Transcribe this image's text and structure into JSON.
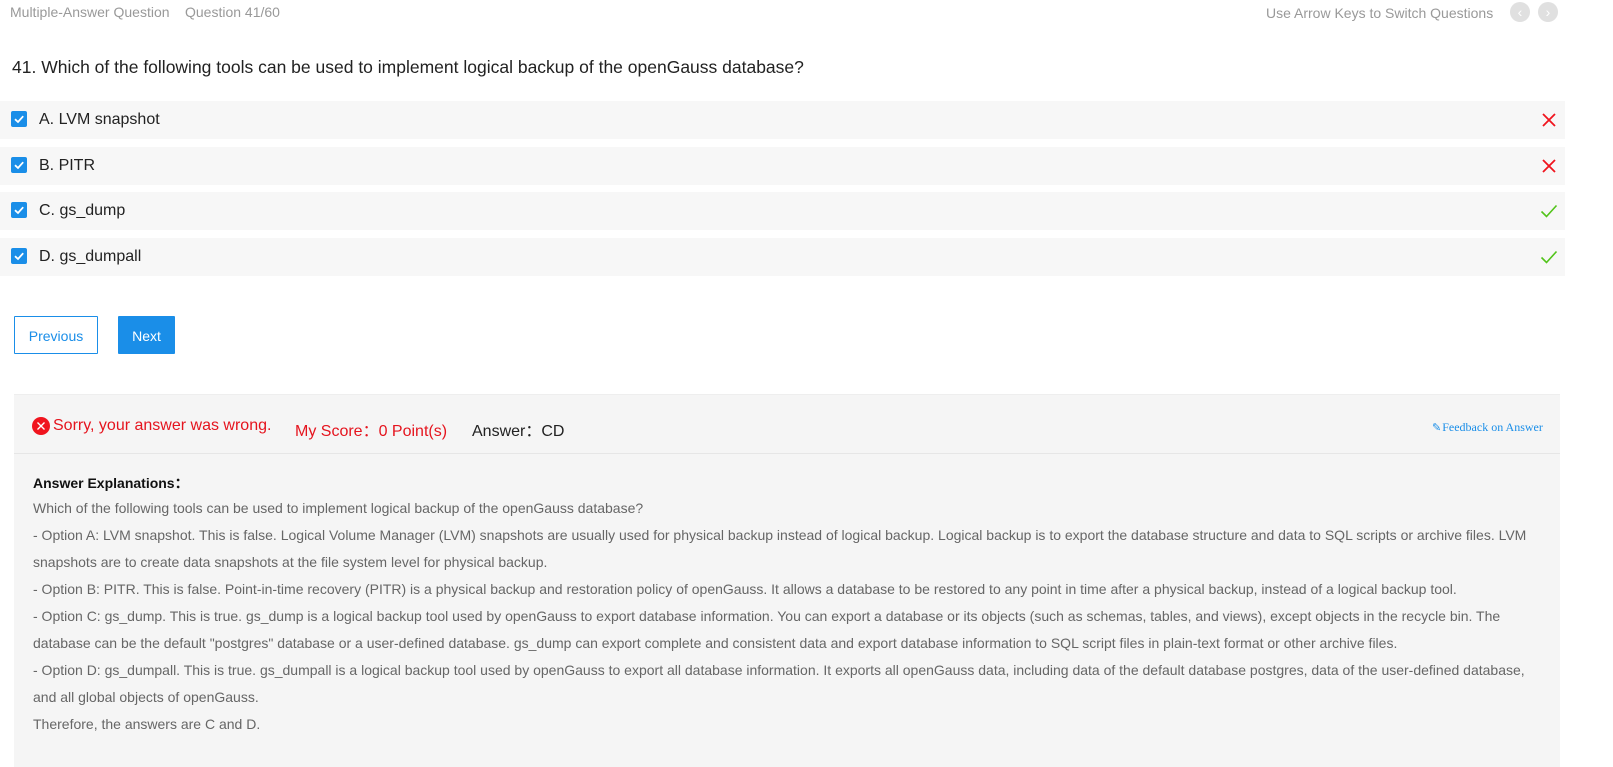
{
  "header": {
    "question_type": "Multiple-Answer Question",
    "question_number": "Question 41/60",
    "hint": "Use Arrow Keys to Switch Questions",
    "prev_arrow": "‹",
    "next_arrow": "›"
  },
  "question": {
    "text": "41. Which of the following tools can be used to implement logical backup of the openGauss database?"
  },
  "options": [
    {
      "label": "A. LVM snapshot",
      "checked": true,
      "result": "wrong"
    },
    {
      "label": "B. PITR",
      "checked": true,
      "result": "wrong"
    },
    {
      "label": "C. gs_dump",
      "checked": true,
      "result": "correct"
    },
    {
      "label": "D. gs_dumpall",
      "checked": true,
      "result": "correct"
    }
  ],
  "buttons": {
    "previous": "Previous",
    "next": "Next"
  },
  "result": {
    "status_text": "Sorry, your answer was wrong.",
    "score_text": "My Score：0 Point(s)",
    "answer_text": "Answer：CD",
    "feedback_icon": "✎",
    "feedback_text": "Feedback on Answer",
    "colors": {
      "wrong": "#e5141e",
      "correct": "#52c41a",
      "accent": "#1a8ee8"
    }
  },
  "explanation": {
    "title": "Answer Explanations：",
    "lines": [
      "Which of the following tools can be used to implement logical backup of the openGauss database?",
      "- Option A: LVM snapshot. This is false. Logical Volume Manager (LVM) snapshots are usually used for physical backup instead of logical backup. Logical backup is to export the database structure and data to SQL scripts or archive files. LVM snapshots are to create data snapshots at the file system level for physical backup.",
      "- Option B: PITR. This is false. Point-in-time recovery (PITR) is a physical backup and restoration policy of openGauss. It allows a database to be restored to any point in time after a physical backup, instead of a logical backup tool.",
      "- Option C: gs_dump. This is true. gs_dump is a logical backup tool used by openGauss to export database information. You can export a database or its objects (such as schemas, tables, and views), except objects in the recycle bin. The database can be the default \"postgres\" database or a user-defined database. gs_dump can export complete and consistent data and export database information to SQL script files in plain-text format or other archive files.",
      "- Option D: gs_dumpall. This is true. gs_dumpall is a logical backup tool used by openGauss to export all database information. It exports all openGauss data, including data of the default database postgres, data of the user-defined database, and all global objects of openGauss.",
      "Therefore, the answers are C and D."
    ]
  }
}
